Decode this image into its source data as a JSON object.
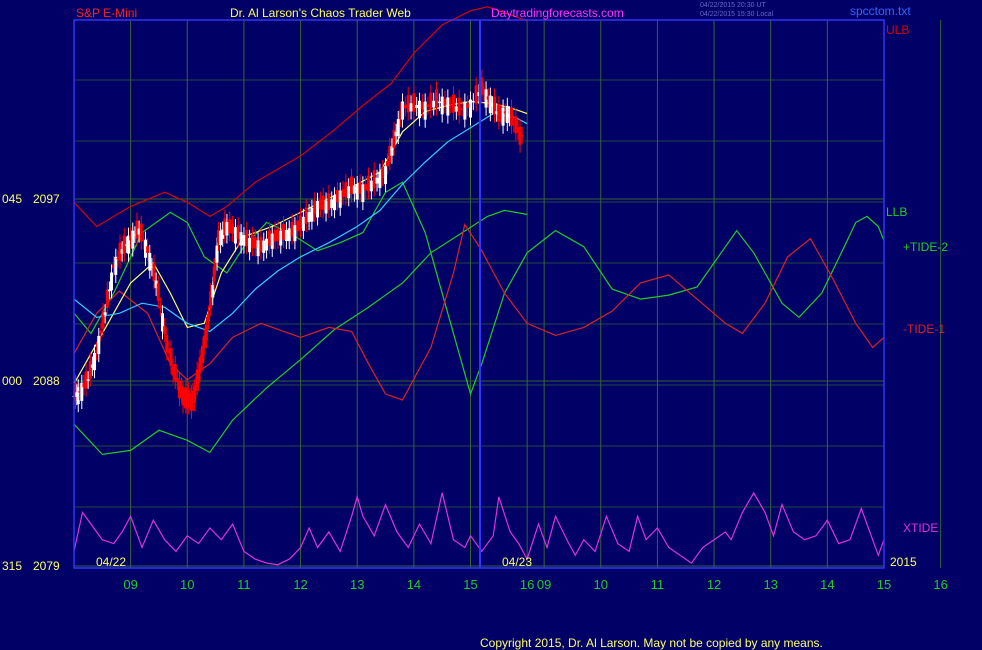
{
  "header": {
    "symbol": "S&P E-Mini",
    "site": "Dr. Al Larson's Chaos Trader Web",
    "url": "Daytradingforecasts.com",
    "time_ut": "04/22/2015 20:30 UT",
    "time_local": "04/22/2015 15:30 Local",
    "file": "spcctom.txt"
  },
  "footer": {
    "copyright": "Copyright 2015, Dr. Al Larson. May not be copied by any means."
  },
  "colors": {
    "background": "#000066",
    "frame": "#3333ff",
    "grid": "#336633",
    "price_up": "#ffffff",
    "price_down": "#ff0000",
    "ulb": "#dd0000",
    "llb": "#22cc22",
    "tide_plus": "#22cc22",
    "tide_minus": "#dd2222",
    "xtide": "#dd33dd",
    "ma_fast": "#ffff66",
    "ma_slow": "#33ccff",
    "hour_label": "#22cc22",
    "date_label": "#ffff66",
    "title": "#ffff66",
    "symbol": "#ff2222",
    "url": "#ff33ff"
  },
  "chart_data": {
    "type": "line",
    "title": "S&P E-Mini",
    "x_hours": [
      "09",
      "10",
      "11",
      "12",
      "13",
      "14",
      "15",
      "16",
      "09",
      "10",
      "11",
      "12",
      "13",
      "14",
      "15",
      "16"
    ],
    "date_labels": [
      "04/22",
      "04/23"
    ],
    "year": "2015",
    "y_ticks": [
      {
        "left": "045",
        "right": "2097",
        "value": 2097
      },
      {
        "left": "000",
        "right": "2088",
        "value": 2088
      },
      {
        "left": "315",
        "right": "2079",
        "value": 2079
      }
    ],
    "ylim": [
      2079,
      2097
    ],
    "legend_right": [
      {
        "label": "ULB",
        "color": "#dd0000"
      },
      {
        "label": "LLB",
        "color": "#22cc22"
      },
      {
        "label": "+TIDE-2",
        "color": "#22cc22"
      },
      {
        "label": "-TIDE-1",
        "color": "#dd2222"
      },
      {
        "label": "XTIDE",
        "color": "#dd33dd"
      }
    ],
    "price_close": [
      [
        8.0,
        2087.4
      ],
      [
        8.1,
        2087.6
      ],
      [
        8.25,
        2088.2
      ],
      [
        8.4,
        2089.6
      ],
      [
        8.55,
        2091.5
      ],
      [
        8.7,
        2093.8
      ],
      [
        8.85,
        2094.6
      ],
      [
        9.0,
        2095.2
      ],
      [
        9.15,
        2095.6
      ],
      [
        9.3,
        2094.6
      ],
      [
        9.45,
        2093.0
      ],
      [
        9.6,
        2090.6
      ],
      [
        9.75,
        2088.7
      ],
      [
        9.9,
        2087.6
      ],
      [
        10.0,
        2087.1
      ],
      [
        10.1,
        2087.3
      ],
      [
        10.2,
        2088.4
      ],
      [
        10.3,
        2090.0
      ],
      [
        10.45,
        2092.7
      ],
      [
        10.55,
        2095.2
      ],
      [
        10.7,
        2095.8
      ],
      [
        10.9,
        2095.4
      ],
      [
        11.1,
        2095.0
      ],
      [
        11.3,
        2094.8
      ],
      [
        11.5,
        2095.2
      ],
      [
        11.7,
        2095.4
      ],
      [
        11.9,
        2095.6
      ],
      [
        12.1,
        2096.2
      ],
      [
        12.3,
        2096.8
      ],
      [
        12.5,
        2096.9
      ],
      [
        12.7,
        2097.3
      ],
      [
        12.9,
        2097.7
      ],
      [
        13.1,
        2097.6
      ],
      [
        13.3,
        2098.0
      ],
      [
        13.5,
        2098.5
      ],
      [
        13.65,
        2100.0
      ],
      [
        13.8,
        2101.7
      ],
      [
        14.0,
        2101.8
      ],
      [
        14.2,
        2101.7
      ],
      [
        14.4,
        2102.0
      ],
      [
        14.6,
        2101.9
      ],
      [
        14.8,
        2101.6
      ],
      [
        15.0,
        2101.8
      ],
      [
        15.2,
        2102.6
      ],
      [
        15.35,
        2102.0
      ],
      [
        15.5,
        2101.3
      ],
      [
        15.65,
        2101.5
      ],
      [
        15.8,
        2100.7
      ],
      [
        15.95,
        2100.2
      ]
    ],
    "series": [
      {
        "name": "ULB",
        "points": [
          [
            8.0,
            2097.0
          ],
          [
            8.4,
            2095.8
          ],
          [
            9.0,
            2096.8
          ],
          [
            9.6,
            2097.5
          ],
          [
            10.0,
            2097.0
          ],
          [
            10.4,
            2096.3
          ],
          [
            10.7,
            2096.8
          ],
          [
            11.2,
            2098.0
          ],
          [
            12.0,
            2099.3
          ],
          [
            12.6,
            2100.6
          ],
          [
            13.1,
            2101.8
          ],
          [
            13.6,
            2102.9
          ],
          [
            14.0,
            2104.4
          ],
          [
            14.5,
            2105.8
          ],
          [
            15.0,
            2106.5
          ],
          [
            15.3,
            2106.7
          ],
          [
            15.6,
            2106.4
          ],
          [
            16.0,
            2106.0
          ]
        ]
      },
      {
        "name": "LLB",
        "points": [
          [
            8.0,
            2086.0
          ],
          [
            8.5,
            2084.5
          ],
          [
            9.0,
            2084.7
          ],
          [
            9.5,
            2085.7
          ],
          [
            10.0,
            2085.2
          ],
          [
            10.4,
            2084.6
          ],
          [
            10.8,
            2086.2
          ],
          [
            11.4,
            2087.8
          ],
          [
            12.0,
            2089.2
          ],
          [
            12.6,
            2090.7
          ],
          [
            13.2,
            2091.8
          ],
          [
            13.8,
            2093.0
          ],
          [
            14.3,
            2094.5
          ],
          [
            14.8,
            2095.4
          ],
          [
            15.3,
            2096.3
          ],
          [
            15.6,
            2096.6
          ],
          [
            16.0,
            2096.4
          ]
        ]
      },
      {
        "name": "+TIDE-2",
        "points": [
          [
            8.0,
            2091.5
          ],
          [
            8.3,
            2090.5
          ],
          [
            8.7,
            2092.5
          ],
          [
            9.2,
            2095.5
          ],
          [
            9.7,
            2096.5
          ],
          [
            10.0,
            2096.0
          ],
          [
            10.3,
            2094.3
          ],
          [
            10.7,
            2093.5
          ],
          [
            11.0,
            2094.8
          ],
          [
            11.4,
            2096.0
          ],
          [
            11.8,
            2095.5
          ],
          [
            12.3,
            2094.6
          ],
          [
            12.7,
            2095.0
          ],
          [
            13.1,
            2095.5
          ],
          [
            13.5,
            2097.5
          ],
          [
            13.8,
            2098.0
          ],
          [
            14.2,
            2095.5
          ],
          [
            14.6,
            2091.5
          ],
          [
            15.0,
            2087.5
          ],
          [
            15.2,
            2089.0
          ],
          [
            15.6,
            2092.5
          ],
          [
            16.0,
            2094.5
          ],
          [
            16.5,
            2095.6
          ],
          [
            17.0,
            2094.8
          ],
          [
            17.5,
            2092.7
          ],
          [
            18.0,
            2092.2
          ],
          [
            18.5,
            2092.4
          ],
          [
            19.0,
            2092.8
          ],
          [
            19.5,
            2094.8
          ],
          [
            19.7,
            2095.6
          ],
          [
            20.0,
            2094.5
          ],
          [
            20.5,
            2092.0
          ],
          [
            20.8,
            2091.3
          ],
          [
            21.2,
            2092.5
          ],
          [
            21.6,
            2094.8
          ],
          [
            21.8,
            2096.0
          ],
          [
            22.0,
            2096.3
          ],
          [
            22.2,
            2095.8
          ],
          [
            22.3,
            2095.1
          ]
        ]
      },
      {
        "name": "-TIDE-1",
        "points": [
          [
            8.0,
            2089.5
          ],
          [
            8.4,
            2091.5
          ],
          [
            8.8,
            2092.6
          ],
          [
            9.3,
            2091.5
          ],
          [
            9.7,
            2089.0
          ],
          [
            10.0,
            2088.2
          ],
          [
            10.4,
            2089.0
          ],
          [
            10.8,
            2090.3
          ],
          [
            11.3,
            2091.0
          ],
          [
            12.0,
            2090.3
          ],
          [
            12.5,
            2090.8
          ],
          [
            12.9,
            2090.6
          ],
          [
            13.2,
            2089.0
          ],
          [
            13.5,
            2087.5
          ],
          [
            13.8,
            2087.2
          ],
          [
            14.3,
            2089.8
          ],
          [
            14.7,
            2093.5
          ],
          [
            14.9,
            2095.9
          ],
          [
            15.2,
            2094.6
          ],
          [
            15.6,
            2092.5
          ],
          [
            16.0,
            2091.0
          ],
          [
            16.5,
            2090.4
          ],
          [
            17.0,
            2090.8
          ],
          [
            17.5,
            2091.6
          ],
          [
            18.0,
            2093.0
          ],
          [
            18.5,
            2093.4
          ],
          [
            19.0,
            2092.2
          ],
          [
            19.5,
            2091.0
          ],
          [
            19.8,
            2090.5
          ],
          [
            20.2,
            2092.0
          ],
          [
            20.6,
            2094.3
          ],
          [
            21.0,
            2095.2
          ],
          [
            21.4,
            2093.2
          ],
          [
            21.8,
            2091.0
          ],
          [
            22.1,
            2089.8
          ],
          [
            22.3,
            2090.3
          ]
        ]
      },
      {
        "name": "MA fast",
        "points": [
          [
            8.0,
            2088.0
          ],
          [
            8.3,
            2089.5
          ],
          [
            8.6,
            2091.0
          ],
          [
            9.0,
            2093.0
          ],
          [
            9.4,
            2094.0
          ],
          [
            9.7,
            2092.5
          ],
          [
            10.0,
            2090.8
          ],
          [
            10.3,
            2091.0
          ],
          [
            10.6,
            2093.5
          ],
          [
            11.0,
            2095.3
          ],
          [
            11.5,
            2095.8
          ],
          [
            12.0,
            2096.5
          ],
          [
            12.5,
            2097.2
          ],
          [
            13.0,
            2097.9
          ],
          [
            13.4,
            2098.5
          ],
          [
            13.8,
            2100.5
          ],
          [
            14.2,
            2101.5
          ],
          [
            14.6,
            2101.8
          ],
          [
            15.0,
            2102.0
          ],
          [
            15.4,
            2101.9
          ],
          [
            15.8,
            2101.6
          ],
          [
            16.0,
            2101.4
          ]
        ]
      },
      {
        "name": "MA slow",
        "points": [
          [
            8.0,
            2092.2
          ],
          [
            8.4,
            2091.3
          ],
          [
            8.8,
            2091.5
          ],
          [
            9.2,
            2092.0
          ],
          [
            9.6,
            2091.8
          ],
          [
            10.0,
            2091.0
          ],
          [
            10.4,
            2090.6
          ],
          [
            10.8,
            2091.5
          ],
          [
            11.2,
            2092.7
          ],
          [
            11.6,
            2093.6
          ],
          [
            12.0,
            2094.3
          ],
          [
            12.5,
            2095.0
          ],
          [
            13.0,
            2095.8
          ],
          [
            13.4,
            2096.6
          ],
          [
            13.8,
            2097.9
          ],
          [
            14.2,
            2099.0
          ],
          [
            14.6,
            2100.0
          ],
          [
            15.0,
            2100.7
          ],
          [
            15.4,
            2101.4
          ],
          [
            15.8,
            2101.2
          ],
          [
            16.0,
            2100.9
          ]
        ]
      }
    ],
    "xtide": [
      [
        8.0,
        0.2
      ],
      [
        8.15,
        0.7
      ],
      [
        8.3,
        0.55
      ],
      [
        8.5,
        0.35
      ],
      [
        8.7,
        0.3
      ],
      [
        8.85,
        0.45
      ],
      [
        9.0,
        0.65
      ],
      [
        9.2,
        0.25
      ],
      [
        9.4,
        0.6
      ],
      [
        9.6,
        0.35
      ],
      [
        9.8,
        0.2
      ],
      [
        10.0,
        0.4
      ],
      [
        10.2,
        0.3
      ],
      [
        10.4,
        0.5
      ],
      [
        10.6,
        0.35
      ],
      [
        10.8,
        0.55
      ],
      [
        11.0,
        0.2
      ],
      [
        11.2,
        0.1
      ],
      [
        11.4,
        0.05
      ],
      [
        11.6,
        0.03
      ],
      [
        11.8,
        0.1
      ],
      [
        12.0,
        0.25
      ],
      [
        12.15,
        0.5
      ],
      [
        12.3,
        0.25
      ],
      [
        12.5,
        0.45
      ],
      [
        12.7,
        0.2
      ],
      [
        12.9,
        0.65
      ],
      [
        13.0,
        0.9
      ],
      [
        13.1,
        0.65
      ],
      [
        13.3,
        0.4
      ],
      [
        13.5,
        0.8
      ],
      [
        13.7,
        0.45
      ],
      [
        13.9,
        0.25
      ],
      [
        14.1,
        0.55
      ],
      [
        14.3,
        0.3
      ],
      [
        14.5,
        0.95
      ],
      [
        14.7,
        0.35
      ],
      [
        14.9,
        0.25
      ],
      [
        15.0,
        0.4
      ],
      [
        15.2,
        0.2
      ],
      [
        15.4,
        0.4
      ],
      [
        15.5,
        0.9
      ],
      [
        15.7,
        0.45
      ],
      [
        15.85,
        0.3
      ],
      [
        16.0,
        0.1
      ],
      [
        16.2,
        0.55
      ],
      [
        16.35,
        0.25
      ],
      [
        16.5,
        0.65
      ],
      [
        16.7,
        0.35
      ],
      [
        16.85,
        0.15
      ],
      [
        17.0,
        0.35
      ],
      [
        17.2,
        0.2
      ],
      [
        17.4,
        0.65
      ],
      [
        17.6,
        0.3
      ],
      [
        17.8,
        0.2
      ],
      [
        17.95,
        0.65
      ],
      [
        18.1,
        0.35
      ],
      [
        18.3,
        0.5
      ],
      [
        18.5,
        0.25
      ],
      [
        18.7,
        0.15
      ],
      [
        18.9,
        0.05
      ],
      [
        19.1,
        0.25
      ],
      [
        19.3,
        0.35
      ],
      [
        19.5,
        0.45
      ],
      [
        19.6,
        0.35
      ],
      [
        19.8,
        0.7
      ],
      [
        20.0,
        0.95
      ],
      [
        20.2,
        0.7
      ],
      [
        20.35,
        0.4
      ],
      [
        20.5,
        0.8
      ],
      [
        20.7,
        0.45
      ],
      [
        20.9,
        0.35
      ],
      [
        21.1,
        0.4
      ],
      [
        21.3,
        0.6
      ],
      [
        21.5,
        0.3
      ],
      [
        21.7,
        0.35
      ],
      [
        21.9,
        0.75
      ],
      [
        22.05,
        0.45
      ],
      [
        22.2,
        0.15
      ],
      [
        22.3,
        0.35
      ]
    ]
  }
}
